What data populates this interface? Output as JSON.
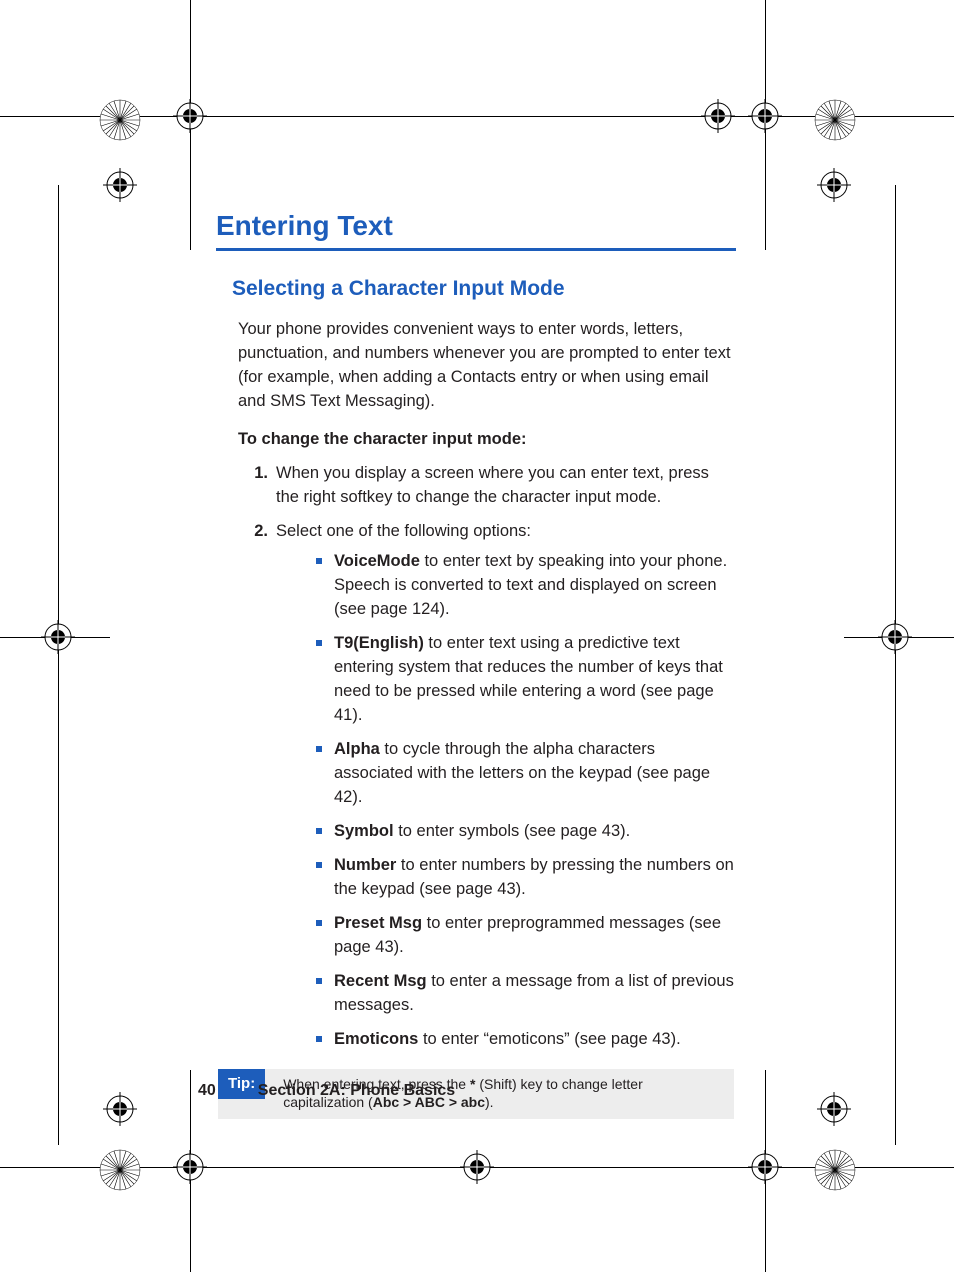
{
  "heading": "Entering Text",
  "subheading": "Selecting a Character Input Mode",
  "intro": "Your phone provides convenient ways to enter words, letters, punctuation, and numbers whenever you are prompted to enter text (for example, when adding a Contacts entry or when using email and SMS Text Messaging).",
  "lead": "To change the character input mode:",
  "steps": [
    "When you display a screen where you can enter text, press the right softkey to change the character input mode.",
    "Select one of the following options:"
  ],
  "options": [
    {
      "bold": "VoiceMode",
      "rest": " to enter text by speaking into your phone. Speech is converted to text and displayed on screen (see page 124)."
    },
    {
      "bold": "T9(English)",
      "rest": " to enter text using a predictive text entering system that reduces the number of keys that need to be pressed while entering a word (see page 41)."
    },
    {
      "bold": "Alpha",
      "rest": " to cycle through the alpha characters associated with the letters on the keypad (see page 42)."
    },
    {
      "bold": "Symbol",
      "rest": " to enter symbols (see page 43)."
    },
    {
      "bold": "Number",
      "rest": " to enter numbers by pressing the numbers on the keypad (see page 43)."
    },
    {
      "bold": "Preset Msg",
      "rest": " to enter preprogrammed messages (see page 43)."
    },
    {
      "bold": "Recent Msg",
      "rest": " to enter a message from a list of previous messages."
    },
    {
      "bold": "Emoticons",
      "rest": " to enter “emoticons” (see page 43)."
    }
  ],
  "tip": {
    "label": "Tip:",
    "pre": "When entering text, press the ",
    "star": "*",
    "mid": " (Shift) key to change letter capitalization (",
    "cap": "Abc > ABC > abc",
    "post": ")."
  },
  "footer": {
    "page": "40",
    "section": "Section 2A: Phone Basics"
  }
}
